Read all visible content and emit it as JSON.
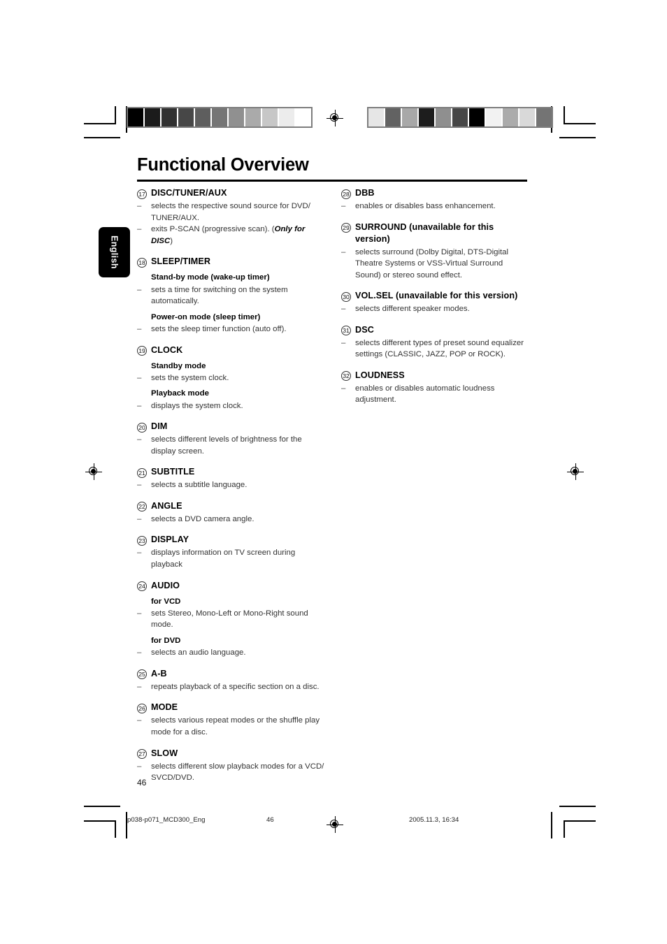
{
  "page": {
    "title": "Functional Overview",
    "language_tab": "English",
    "folio": "46"
  },
  "calibration": {
    "left_strip": [
      "#000000",
      "#1b1b1b",
      "#303030",
      "#474747",
      "#5e5e5e",
      "#757575",
      "#909090",
      "#aaaaaa",
      "#c7c7c7",
      "#ececec",
      "#ffffff"
    ],
    "right_strip": [
      "#e6e6e6",
      "#626262",
      "#a8a8a8",
      "#1d1d1d",
      "#8f8f8f",
      "#474747",
      "#000000",
      "#f2f2f2",
      "#ababab",
      "#d9d9d9",
      "#747474"
    ]
  },
  "left_column": [
    {
      "number": "17",
      "name": "DISC/TUNER/AUX",
      "blocks": [
        {
          "kind": "bullet",
          "text": "selects the respective sound source for DVD/ TUNER/AUX."
        },
        {
          "kind": "bullet",
          "text": "exits P-SCAN (progressive scan). (",
          "italic": "Only for DISC",
          "tail": ")"
        }
      ]
    },
    {
      "number": "18",
      "name": "SLEEP/TIMER",
      "blocks": [
        {
          "kind": "subhead",
          "text": "Stand-by mode (wake-up timer)"
        },
        {
          "kind": "bullet",
          "text": "sets a time for switching on the system automatically."
        },
        {
          "kind": "subhead",
          "text": "Power-on mode (sleep timer)"
        },
        {
          "kind": "bullet",
          "text": "sets the sleep timer function (auto off)."
        }
      ]
    },
    {
      "number": "19",
      "name": "CLOCK",
      "blocks": [
        {
          "kind": "subhead",
          "text": "Standby mode"
        },
        {
          "kind": "bullet",
          "text": "sets the system clock."
        },
        {
          "kind": "subhead",
          "text": "Playback mode"
        },
        {
          "kind": "bullet",
          "text": "displays the system clock."
        }
      ]
    },
    {
      "number": "20",
      "name": "DIM",
      "blocks": [
        {
          "kind": "bullet",
          "text": "selects different levels of brightness for the display screen."
        }
      ]
    },
    {
      "number": "21",
      "name": "SUBTITLE",
      "blocks": [
        {
          "kind": "bullet",
          "text": "selects a subtitle language."
        }
      ]
    },
    {
      "number": "22",
      "name": "ANGLE",
      "blocks": [
        {
          "kind": "bullet",
          "text": "selects a DVD camera angle."
        }
      ]
    },
    {
      "number": "23",
      "name": "DISPLAY",
      "blocks": [
        {
          "kind": "bullet",
          "text": "displays information on TV screen during playback"
        }
      ]
    },
    {
      "number": "24",
      "name": "AUDIO",
      "blocks": [
        {
          "kind": "subhead",
          "text": "for VCD"
        },
        {
          "kind": "bullet",
          "text": "sets Stereo, Mono-Left or Mono-Right sound mode."
        },
        {
          "kind": "subhead",
          "text": "for DVD"
        },
        {
          "kind": "bullet",
          "text": "selects an audio language."
        }
      ]
    },
    {
      "number": "25",
      "name": "A-B",
      "blocks": [
        {
          "kind": "bullet",
          "text": "repeats playback of a specific section on a disc."
        }
      ]
    },
    {
      "number": "26",
      "name": "MODE",
      "blocks": [
        {
          "kind": "bullet",
          "text": "selects various repeat modes or the shuffle play mode for a disc."
        }
      ]
    },
    {
      "number": "27",
      "name": "SLOW",
      "blocks": [
        {
          "kind": "bullet",
          "text": "selects different slow playback modes for a VCD/ SVCD/DVD."
        }
      ]
    }
  ],
  "right_column": [
    {
      "number": "28",
      "name": "DBB",
      "blocks": [
        {
          "kind": "bullet",
          "text": "enables or disables bass enhancement."
        }
      ]
    },
    {
      "number": "29",
      "name": "SURROUND (unavailable for this version)",
      "blocks": [
        {
          "kind": "bullet",
          "text": "selects surround (Dolby Digital, DTS-Digital Theatre Systems or VSS-Virtual Surround Sound) or stereo sound effect."
        }
      ]
    },
    {
      "number": "30",
      "name": "VOL.SEL (unavailable for this version)",
      "blocks": [
        {
          "kind": "bullet",
          "text": "selects different speaker modes."
        }
      ]
    },
    {
      "number": "31",
      "name": "DSC",
      "blocks": [
        {
          "kind": "bullet",
          "text": "selects different types of preset sound equalizer settings (CLASSIC, JAZZ, POP or ROCK)."
        }
      ]
    },
    {
      "number": "32",
      "name": "LOUDNESS",
      "blocks": [
        {
          "kind": "bullet",
          "text": "enables or disables automatic loudness adjustment."
        }
      ]
    }
  ],
  "footer": {
    "filename": "p038-p071_MCD300_Eng",
    "page_number": "46",
    "timestamp": "2005.11.3, 16:34"
  }
}
